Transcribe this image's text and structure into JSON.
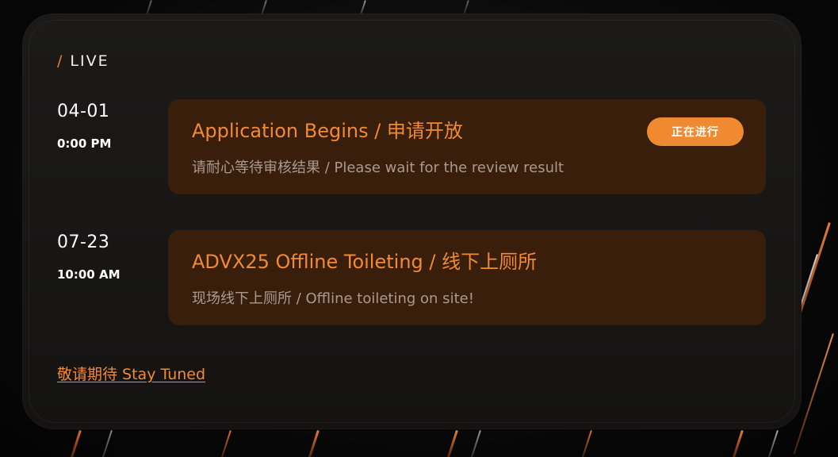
{
  "section": {
    "slash": "/",
    "title": "LIVE"
  },
  "events": [
    {
      "date": "04-01",
      "time": "0:00 PM",
      "title": "Application Begins / 申请开放",
      "description": "请耐心等待审核结果 / Please wait for the review result",
      "status": "正在进行"
    },
    {
      "date": "07-23",
      "time": "10:00 AM",
      "title": "ADVX25 Offline Toileting / 线下上厕所",
      "description": "现场线下上厕所 / Offline toileting on site!"
    }
  ],
  "footer": {
    "stay_tuned": "敬请期待 Stay Tuned"
  },
  "colors": {
    "accent": "#f08a35",
    "event_bg": "#3a1e0c",
    "card_bg": "#1b1a19",
    "page_bg": "#0a0a0a"
  }
}
